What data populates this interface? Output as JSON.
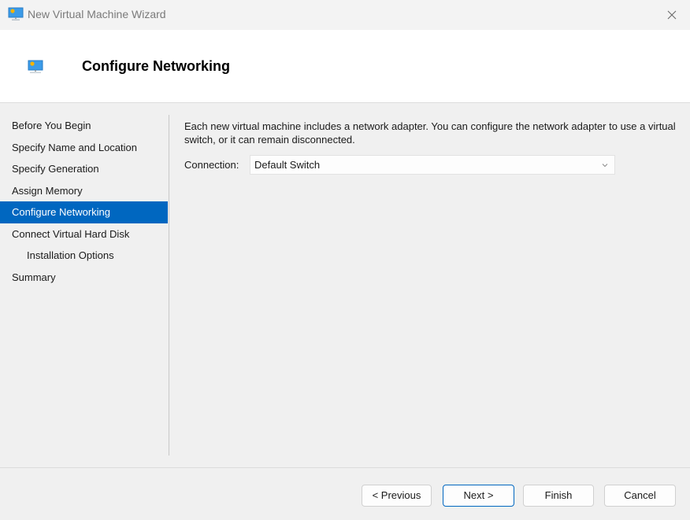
{
  "window": {
    "title": "New Virtual Machine Wizard",
    "icon": "monitor-icon",
    "close_icon": "close-icon"
  },
  "header": {
    "title": "Configure Networking",
    "icon": "monitor-icon"
  },
  "sidebar": {
    "items": [
      {
        "label": "Before You Begin",
        "active": false,
        "indent": false
      },
      {
        "label": "Specify Name and Location",
        "active": false,
        "indent": false
      },
      {
        "label": "Specify Generation",
        "active": false,
        "indent": false
      },
      {
        "label": "Assign Memory",
        "active": false,
        "indent": false
      },
      {
        "label": "Configure Networking",
        "active": true,
        "indent": false
      },
      {
        "label": "Connect Virtual Hard Disk",
        "active": false,
        "indent": false
      },
      {
        "label": "Installation Options",
        "active": false,
        "indent": true
      },
      {
        "label": "Summary",
        "active": false,
        "indent": false
      }
    ]
  },
  "main": {
    "description": "Each new virtual machine includes a network adapter. You can configure the network adapter to use a virtual switch, or it can remain disconnected.",
    "connection_label": "Connection:",
    "connection_value": "Default Switch"
  },
  "footer": {
    "previous_label": "< Previous",
    "next_label": "Next >",
    "finish_label": "Finish",
    "cancel_label": "Cancel"
  },
  "colors": {
    "accent": "#0067c0"
  }
}
